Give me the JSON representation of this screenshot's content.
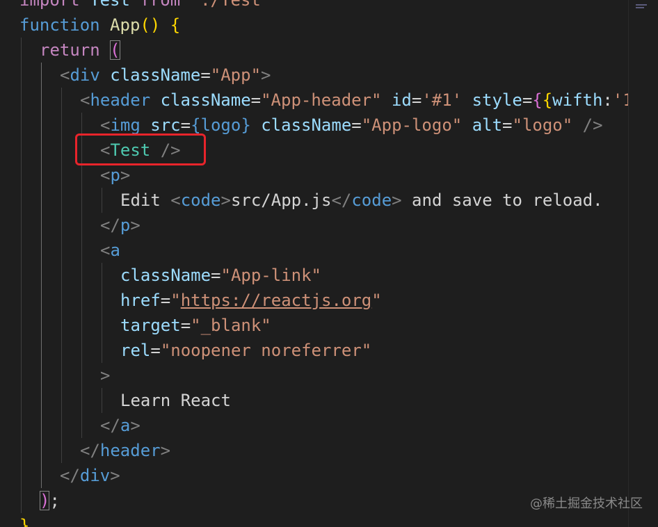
{
  "editor": {
    "lines": [
      {
        "indent": 0,
        "tokens": [
          {
            "t": "import",
            "c": "tk-control"
          },
          {
            "t": " ",
            "c": "tk-text"
          },
          {
            "t": "Test",
            "c": "tk-attr"
          },
          {
            "t": " ",
            "c": "tk-text"
          },
          {
            "t": "from",
            "c": "tk-control"
          },
          {
            "t": " ",
            "c": "tk-text"
          },
          {
            "t": "'./Test'",
            "c": "tk-string"
          }
        ]
      },
      {
        "indent": 0,
        "tokens": [
          {
            "t": "function",
            "c": "tk-keyword"
          },
          {
            "t": " ",
            "c": "tk-text"
          },
          {
            "t": "App",
            "c": "tk-func"
          },
          {
            "t": "()",
            "c": "tk-paren"
          },
          {
            "t": " ",
            "c": "tk-text"
          },
          {
            "t": "{",
            "c": "tk-paren"
          }
        ]
      },
      {
        "indent": 1,
        "tokens": [
          {
            "t": "return",
            "c": "tk-control"
          },
          {
            "t": " ",
            "c": "tk-text"
          },
          {
            "t": "(",
            "c": "tk-brace2 bracket-match"
          }
        ]
      },
      {
        "indent": 2,
        "tokens": [
          {
            "t": "<",
            "c": "tk-angle"
          },
          {
            "t": "div",
            "c": "tk-tag"
          },
          {
            "t": " ",
            "c": "tk-text"
          },
          {
            "t": "className",
            "c": "tk-attr"
          },
          {
            "t": "=",
            "c": "tk-text"
          },
          {
            "t": "\"App\"",
            "c": "tk-string"
          },
          {
            "t": ">",
            "c": "tk-angle"
          }
        ]
      },
      {
        "indent": 3,
        "tokens": [
          {
            "t": "<",
            "c": "tk-angle"
          },
          {
            "t": "header",
            "c": "tk-tag"
          },
          {
            "t": " ",
            "c": "tk-text"
          },
          {
            "t": "className",
            "c": "tk-attr"
          },
          {
            "t": "=",
            "c": "tk-text"
          },
          {
            "t": "\"App-header\"",
            "c": "tk-string"
          },
          {
            "t": " ",
            "c": "tk-text"
          },
          {
            "t": "id",
            "c": "tk-attr"
          },
          {
            "t": "=",
            "c": "tk-text"
          },
          {
            "t": "'#1'",
            "c": "tk-string"
          },
          {
            "t": " ",
            "c": "tk-text"
          },
          {
            "t": "style",
            "c": "tk-attr"
          },
          {
            "t": "=",
            "c": "tk-text"
          },
          {
            "t": "{",
            "c": "tk-brace2"
          },
          {
            "t": "{",
            "c": "tk-paren"
          },
          {
            "t": "wifth",
            "c": "tk-attr"
          },
          {
            "t": ":",
            "c": "tk-text"
          },
          {
            "t": "'1",
            "c": "tk-string"
          }
        ]
      },
      {
        "indent": 4,
        "tokens": [
          {
            "t": "<",
            "c": "tk-angle"
          },
          {
            "t": "img",
            "c": "tk-tag"
          },
          {
            "t": " ",
            "c": "tk-text"
          },
          {
            "t": "src",
            "c": "tk-attr"
          },
          {
            "t": "=",
            "c": "tk-text"
          },
          {
            "t": "{logo}",
            "c": "tk-keyword"
          },
          {
            "t": " ",
            "c": "tk-text"
          },
          {
            "t": "className",
            "c": "tk-attr"
          },
          {
            "t": "=",
            "c": "tk-text"
          },
          {
            "t": "\"App-logo\"",
            "c": "tk-string"
          },
          {
            "t": " ",
            "c": "tk-text"
          },
          {
            "t": "alt",
            "c": "tk-attr"
          },
          {
            "t": "=",
            "c": "tk-text"
          },
          {
            "t": "\"logo\"",
            "c": "tk-string"
          },
          {
            "t": " ",
            "c": "tk-text"
          },
          {
            "t": "/>",
            "c": "tk-angle"
          }
        ]
      },
      {
        "indent": 4,
        "tokens": [
          {
            "t": "<",
            "c": "tk-angle"
          },
          {
            "t": "Test",
            "c": "tk-comp"
          },
          {
            "t": " ",
            "c": "tk-text"
          },
          {
            "t": "/>",
            "c": "tk-angle"
          }
        ]
      },
      {
        "indent": 4,
        "tokens": [
          {
            "t": "<",
            "c": "tk-angle"
          },
          {
            "t": "p",
            "c": "tk-tag"
          },
          {
            "t": ">",
            "c": "tk-angle"
          }
        ]
      },
      {
        "indent": 5,
        "tokens": [
          {
            "t": "Edit",
            "c": "tk-text"
          },
          {
            "t": " ",
            "c": "tk-text"
          },
          {
            "t": "<",
            "c": "tk-angle"
          },
          {
            "t": "code",
            "c": "tk-tag"
          },
          {
            "t": ">",
            "c": "tk-angle"
          },
          {
            "t": "src/App.js",
            "c": "tk-text"
          },
          {
            "t": "</",
            "c": "tk-angle"
          },
          {
            "t": "code",
            "c": "tk-tag"
          },
          {
            "t": ">",
            "c": "tk-angle"
          },
          {
            "t": " and save to reload.",
            "c": "tk-text"
          }
        ]
      },
      {
        "indent": 4,
        "tokens": [
          {
            "t": "</",
            "c": "tk-angle"
          },
          {
            "t": "p",
            "c": "tk-tag"
          },
          {
            "t": ">",
            "c": "tk-angle"
          }
        ]
      },
      {
        "indent": 4,
        "tokens": [
          {
            "t": "<",
            "c": "tk-angle"
          },
          {
            "t": "a",
            "c": "tk-tag"
          }
        ]
      },
      {
        "indent": 5,
        "tokens": [
          {
            "t": "className",
            "c": "tk-attr"
          },
          {
            "t": "=",
            "c": "tk-text"
          },
          {
            "t": "\"App-link\"",
            "c": "tk-string"
          }
        ]
      },
      {
        "indent": 5,
        "tokens": [
          {
            "t": "href",
            "c": "tk-attr"
          },
          {
            "t": "=",
            "c": "tk-text"
          },
          {
            "t": "\"",
            "c": "tk-string"
          },
          {
            "t": "https://reactjs.org",
            "c": "tk-string tk-link"
          },
          {
            "t": "\"",
            "c": "tk-string"
          }
        ]
      },
      {
        "indent": 5,
        "tokens": [
          {
            "t": "target",
            "c": "tk-attr"
          },
          {
            "t": "=",
            "c": "tk-text"
          },
          {
            "t": "\"_blank\"",
            "c": "tk-string"
          }
        ]
      },
      {
        "indent": 5,
        "tokens": [
          {
            "t": "rel",
            "c": "tk-attr"
          },
          {
            "t": "=",
            "c": "tk-text"
          },
          {
            "t": "\"noopener noreferrer\"",
            "c": "tk-string"
          }
        ]
      },
      {
        "indent": 4,
        "tokens": [
          {
            "t": ">",
            "c": "tk-angle"
          }
        ]
      },
      {
        "indent": 5,
        "tokens": [
          {
            "t": "Learn React",
            "c": "tk-text"
          }
        ]
      },
      {
        "indent": 4,
        "tokens": [
          {
            "t": "</",
            "c": "tk-angle"
          },
          {
            "t": "a",
            "c": "tk-tag"
          },
          {
            "t": ">",
            "c": "tk-angle"
          }
        ]
      },
      {
        "indent": 3,
        "tokens": [
          {
            "t": "</",
            "c": "tk-angle"
          },
          {
            "t": "header",
            "c": "tk-tag"
          },
          {
            "t": ">",
            "c": "tk-angle"
          }
        ]
      },
      {
        "indent": 2,
        "tokens": [
          {
            "t": "</",
            "c": "tk-angle"
          },
          {
            "t": "div",
            "c": "tk-tag"
          },
          {
            "t": ">",
            "c": "tk-angle"
          }
        ]
      },
      {
        "indent": 1,
        "tokens": [
          {
            "t": ")",
            "c": "tk-brace2 bracket-match"
          },
          {
            "t": ";",
            "c": "tk-text"
          }
        ]
      },
      {
        "indent": 0,
        "tokens": [
          {
            "t": "}",
            "c": "tk-paren"
          }
        ]
      }
    ]
  },
  "highlight": {
    "color": "#e8242b",
    "target_line": 7
  },
  "watermark": "@稀土掘金技术社区",
  "colors": {
    "background": "#1e1e1e",
    "keyword": "#569cd6",
    "control": "#c586c0",
    "function": "#dcdcaa",
    "component": "#4ec9b0",
    "attribute": "#9cdcfe",
    "string": "#ce9178",
    "text": "#d4d4d4"
  }
}
